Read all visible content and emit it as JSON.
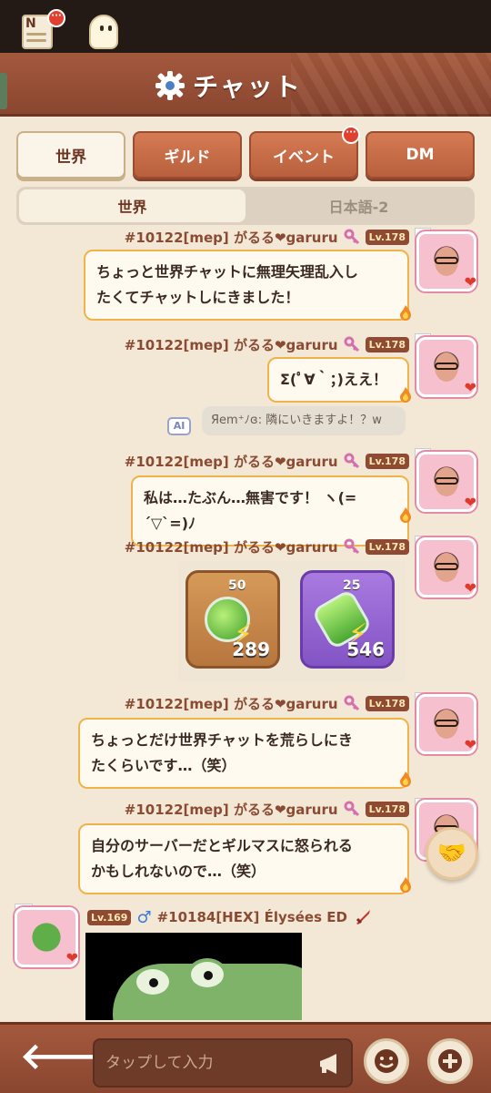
{
  "header": {
    "title": "チャット",
    "notice_badge": "···"
  },
  "tabs": [
    {
      "label": "世界",
      "active": true
    },
    {
      "label": "ギルド",
      "active": false
    },
    {
      "label": "イベント",
      "active": false,
      "badge": "···"
    },
    {
      "label": "DM",
      "active": false
    }
  ],
  "subtabs": [
    {
      "label": "世界",
      "active": true
    },
    {
      "label": "日本語-2",
      "active": false
    }
  ],
  "messages": [
    {
      "name": "#10122[mep] がるる❤garuru",
      "level": "Lv.178",
      "text_lines": [
        "ちょっと世界チャットに無理矢理乱入し",
        "たくてチャットしにきました！"
      ]
    },
    {
      "name": "#10122[mep] がるる❤garuru",
      "level": "Lv.178",
      "text_lines": [
        "Σ(ﾟ∀｀；)ええ！"
      ]
    },
    {
      "name": "#10122[mep] がるる❤garuru",
      "level": "Lv.178",
      "text_lines": [
        "私は…たぶん…無害です！ ヽ(=´▽`=)ﾉ"
      ]
    },
    {
      "name": "#10122[mep] がるる❤garuru",
      "level": "Lv.178",
      "potions": [
        {
          "top": "50",
          "count": "289",
          "color": "#d69a58"
        },
        {
          "top": "25",
          "count": "546",
          "color": "#a97ae0"
        }
      ]
    },
    {
      "name": "#10122[mep] がるる❤garuru",
      "level": "Lv.178",
      "text_lines": [
        "ちょっとだけ世界チャットを荒らしにき",
        "たくらいです…（笑）"
      ]
    },
    {
      "name": "#10122[mep] がるる❤garuru",
      "level": "Lv.178",
      "text_lines": [
        "自分のサーバーだとギルマスに怒られる",
        "かもしれないので…（笑）"
      ]
    }
  ],
  "system_message": {
    "ai_label": "AI",
    "text": "Яem⁺ﾉɞ: 隣にいきますよ！？w"
  },
  "other_message": {
    "level": "Lv.169",
    "name": "#10184[HEX] Élysées ED"
  },
  "composer": {
    "placeholder": "タップして入力"
  },
  "colors": {
    "accent": "#b8603d",
    "bubble_border": "#f0b34a",
    "header": "#a4593d"
  }
}
